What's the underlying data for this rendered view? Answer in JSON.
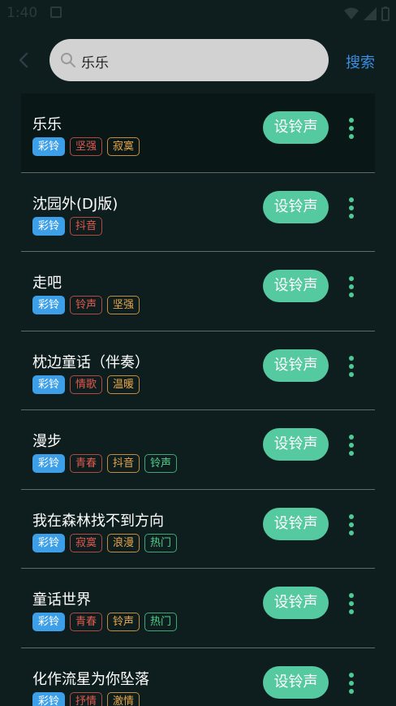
{
  "status_bar": {
    "time": "1:40"
  },
  "header": {
    "search_value": "乐乐",
    "search_button": "搜索"
  },
  "colors": {
    "accent": "#55c9a0",
    "link": "#3a8fe4",
    "background": "#0e1d1d",
    "tag_blue": "#3d9fe8",
    "tag_red": "#e25a4f",
    "tag_orange": "#e8a74a",
    "tag_green": "#4ed08c"
  },
  "set_button_label": "设铃声",
  "items": [
    {
      "title": "乐乐",
      "tags": [
        {
          "text": "彩铃",
          "color": "blue"
        },
        {
          "text": "坚强",
          "color": "red"
        },
        {
          "text": "寂寞",
          "color": "orange"
        }
      ]
    },
    {
      "title": "沈园外(DJ版)",
      "tags": [
        {
          "text": "彩铃",
          "color": "blue"
        },
        {
          "text": "抖音",
          "color": "red"
        }
      ]
    },
    {
      "title": "走吧",
      "tags": [
        {
          "text": "彩铃",
          "color": "blue"
        },
        {
          "text": "铃声",
          "color": "red"
        },
        {
          "text": "坚强",
          "color": "orange"
        }
      ]
    },
    {
      "title": "枕边童话（伴奏）",
      "tags": [
        {
          "text": "彩铃",
          "color": "blue"
        },
        {
          "text": "情歌",
          "color": "red"
        },
        {
          "text": "温暖",
          "color": "orange"
        }
      ]
    },
    {
      "title": "漫步",
      "tags": [
        {
          "text": "彩铃",
          "color": "blue"
        },
        {
          "text": "青春",
          "color": "red"
        },
        {
          "text": "抖音",
          "color": "orange"
        },
        {
          "text": "铃声",
          "color": "green"
        }
      ]
    },
    {
      "title": "我在森林找不到方向",
      "tags": [
        {
          "text": "彩铃",
          "color": "blue"
        },
        {
          "text": "寂寞",
          "color": "red"
        },
        {
          "text": "浪漫",
          "color": "orange"
        },
        {
          "text": "热门",
          "color": "green"
        }
      ]
    },
    {
      "title": "童话世界",
      "tags": [
        {
          "text": "彩铃",
          "color": "blue"
        },
        {
          "text": "青春",
          "color": "red"
        },
        {
          "text": "铃声",
          "color": "orange"
        },
        {
          "text": "热门",
          "color": "green"
        }
      ]
    },
    {
      "title": "化作流星为你坠落",
      "tags": [
        {
          "text": "彩铃",
          "color": "blue"
        },
        {
          "text": "抒情",
          "color": "red"
        },
        {
          "text": "激情",
          "color": "orange"
        }
      ]
    }
  ]
}
